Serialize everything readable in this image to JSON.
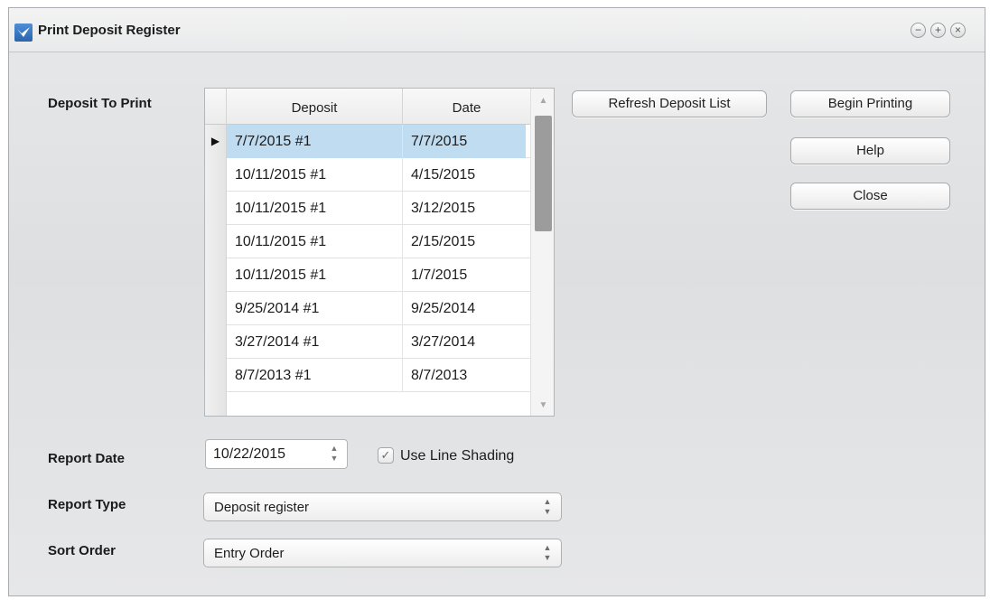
{
  "window": {
    "title": "Print Deposit Register",
    "controls": {
      "minimize": "−",
      "maximize": "+",
      "close": "×"
    }
  },
  "labels": {
    "deposit_to_print": "Deposit To Print",
    "report_date": "Report Date",
    "report_type": "Report Type",
    "sort_order": "Sort Order"
  },
  "deposit_table": {
    "columns": [
      "Deposit",
      "Date"
    ],
    "selected_index": 0,
    "rows": [
      {
        "deposit": "7/7/2015 #1",
        "date": "7/7/2015"
      },
      {
        "deposit": "10/11/2015 #1",
        "date": "4/15/2015"
      },
      {
        "deposit": "10/11/2015 #1",
        "date": "3/12/2015"
      },
      {
        "deposit": "10/11/2015 #1",
        "date": "2/15/2015"
      },
      {
        "deposit": "10/11/2015 #1",
        "date": "1/7/2015"
      },
      {
        "deposit": "9/25/2014 #1",
        "date": "9/25/2014"
      },
      {
        "deposit": "3/27/2014 #1",
        "date": "3/27/2014"
      },
      {
        "deposit": "8/7/2013 #1",
        "date": "8/7/2013"
      }
    ]
  },
  "buttons": {
    "refresh": "Refresh Deposit List",
    "begin_printing": "Begin Printing",
    "help": "Help",
    "close": "Close"
  },
  "report_date": {
    "value": "10/22/2015"
  },
  "use_line_shading": {
    "label": "Use Line Shading",
    "checked": true
  },
  "report_type": {
    "value": "Deposit register"
  },
  "sort_order": {
    "value": "Entry Order"
  }
}
